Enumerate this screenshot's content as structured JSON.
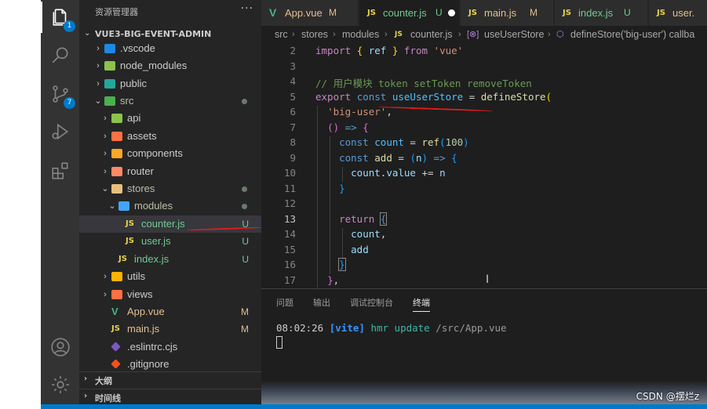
{
  "activity_bar": {
    "items": [
      {
        "name": "explorer-icon",
        "badge": "1"
      },
      {
        "name": "search-icon",
        "badge": ""
      },
      {
        "name": "source-control-icon",
        "badge": "7"
      },
      {
        "name": "run-debug-icon",
        "badge": ""
      },
      {
        "name": "extensions-icon",
        "badge": ""
      }
    ],
    "bottom": [
      {
        "name": "account-icon"
      },
      {
        "name": "settings-gear-icon"
      }
    ]
  },
  "sidebar": {
    "title": "资源管理器",
    "more": "···",
    "root": "VUE3-BIG-EVENT-ADMIN",
    "tree": [
      {
        "label": ".vscode",
        "icon": "folder-vscode",
        "twisty": "›",
        "status": "",
        "dot": false,
        "color": "#1e88e5",
        "kind": "folder"
      },
      {
        "label": "node_modules",
        "icon": "folder-node",
        "twisty": "›",
        "status": "",
        "dot": false,
        "color": "#8bc34a",
        "kind": "folder"
      },
      {
        "label": "public",
        "icon": "folder-public",
        "twisty": "›",
        "status": "",
        "dot": false,
        "color": "#26a69a",
        "kind": "folder"
      },
      {
        "label": "src",
        "icon": "folder-src",
        "twisty": "⌄",
        "status": "",
        "dot": true,
        "color": "#4caf50",
        "kind": "folder-open"
      },
      {
        "label": "api",
        "icon": "folder-api",
        "twisty": "›",
        "status": "",
        "dot": false,
        "color": "#8bc34a",
        "kind": "folder"
      },
      {
        "label": "assets",
        "icon": "folder-assets",
        "twisty": "›",
        "status": "",
        "dot": false,
        "color": "#ff7043",
        "kind": "folder"
      },
      {
        "label": "components",
        "icon": "folder-components",
        "twisty": "›",
        "status": "",
        "dot": false,
        "color": "#ffa726",
        "kind": "folder"
      },
      {
        "label": "router",
        "icon": "folder-router",
        "twisty": "›",
        "status": "",
        "dot": false,
        "color": "#ff8a65",
        "kind": "folder"
      },
      {
        "label": "stores",
        "icon": "folder-stores",
        "twisty": "⌄",
        "status": "",
        "dot": true,
        "color": "#e8c07d",
        "kind": "folder-open"
      },
      {
        "label": "modules",
        "icon": "folder-modules",
        "twisty": "⌄",
        "status": "",
        "dot": true,
        "color": "#42a5f5",
        "kind": "folder-open"
      },
      {
        "label": "counter.js",
        "icon": "js-file",
        "twisty": "",
        "status": "U",
        "dot": false,
        "color": "#e8d44d",
        "kind": "js",
        "selected": true
      },
      {
        "label": "user.js",
        "icon": "js-file",
        "twisty": "",
        "status": "U",
        "dot": false,
        "color": "#e8d44d",
        "kind": "js"
      },
      {
        "label": "index.js",
        "icon": "js-file",
        "twisty": "",
        "status": "U",
        "dot": false,
        "color": "#e8d44d",
        "kind": "js"
      },
      {
        "label": "utils",
        "icon": "folder-utils",
        "twisty": "›",
        "status": "",
        "dot": false,
        "color": "#ffb300",
        "kind": "folder"
      },
      {
        "label": "views",
        "icon": "folder-views",
        "twisty": "›",
        "status": "",
        "dot": false,
        "color": "#ff7043",
        "kind": "folder"
      },
      {
        "label": "App.vue",
        "icon": "vue-file",
        "twisty": "",
        "status": "M",
        "dot": false,
        "color": "#41b883",
        "kind": "vue"
      },
      {
        "label": "main.js",
        "icon": "js-file",
        "twisty": "",
        "status": "M",
        "dot": false,
        "color": "#e8d44d",
        "kind": "js"
      },
      {
        "label": ".eslintrc.cjs",
        "icon": "eslint-file",
        "twisty": "",
        "status": "",
        "dot": false,
        "color": "#7e57c2",
        "kind": "file"
      },
      {
        "label": ".gitignore",
        "icon": "git-file",
        "twisty": "",
        "status": "",
        "dot": false,
        "color": "#f4511e",
        "kind": "file"
      }
    ],
    "outline": "大纲",
    "timeline": "时间线"
  },
  "tabs": [
    {
      "icon": "vue",
      "icon_text": "V",
      "name": "App.vue",
      "status": "M",
      "active": false
    },
    {
      "icon": "js",
      "icon_text": "JS",
      "name": "counter.js",
      "status": "U",
      "active": true,
      "dirty": true
    },
    {
      "icon": "js",
      "icon_text": "JS",
      "name": "main.js",
      "status": "M",
      "active": false
    },
    {
      "icon": "js",
      "icon_text": "JS",
      "name": "index.js",
      "status": "U",
      "active": false
    },
    {
      "icon": "js",
      "icon_text": "JS",
      "name": "user.",
      "status": "",
      "active": false
    }
  ],
  "breadcrumb": {
    "parts": [
      "src",
      "stores",
      "modules"
    ],
    "file_icon": "JS",
    "file": "counter.js",
    "symbol1": "useUserStore",
    "symbol2": "defineStore('big-user') callba"
  },
  "editor": {
    "line_numbers": [
      "2",
      "3",
      "4",
      "5",
      "6",
      "7",
      "8",
      "9",
      "10",
      "11",
      "12",
      "13",
      "14",
      "15",
      "16",
      "17"
    ],
    "current_line": "13",
    "lines": [
      [
        [
          "kw-ctrl",
          "import "
        ],
        [
          "br1",
          "{ "
        ],
        [
          "var",
          "ref "
        ],
        [
          "br1",
          "} "
        ],
        [
          "kw-ctrl",
          "from "
        ],
        [
          "str",
          "'vue'"
        ]
      ],
      [],
      [
        [
          "cmt",
          "// 用户模块 token setToken removeToken"
        ]
      ],
      [
        [
          "kw-ctrl",
          "export "
        ],
        [
          "kw",
          "const "
        ],
        [
          "const",
          "useUserStore "
        ],
        [
          "pun",
          "= "
        ],
        [
          "fn",
          "defineStore"
        ],
        [
          "br1",
          "("
        ]
      ],
      [
        [
          "pun",
          "  "
        ],
        [
          "str",
          "'big-user'"
        ],
        [
          "pun",
          ","
        ]
      ],
      [
        [
          "pun",
          "  "
        ],
        [
          "br2",
          "()"
        ],
        [
          "kw",
          " => "
        ],
        [
          "br2",
          "{"
        ]
      ],
      [
        [
          "pun",
          "    "
        ],
        [
          "kw",
          "const "
        ],
        [
          "const",
          "count "
        ],
        [
          "pun",
          "= "
        ],
        [
          "fn",
          "ref"
        ],
        [
          "br3",
          "("
        ],
        [
          "num",
          "100"
        ],
        [
          "br3",
          ")"
        ]
      ],
      [
        [
          "pun",
          "    "
        ],
        [
          "kw",
          "const "
        ],
        [
          "fn",
          "add "
        ],
        [
          "pun",
          "= "
        ],
        [
          "br3",
          "("
        ],
        [
          "var",
          "n"
        ],
        [
          "br3",
          ")"
        ],
        [
          "kw",
          " => "
        ],
        [
          "br3",
          "{"
        ]
      ],
      [
        [
          "pun",
          "      "
        ],
        [
          "var",
          "count"
        ],
        [
          "pun",
          "."
        ],
        [
          "var",
          "value "
        ],
        [
          "pun",
          "+= "
        ],
        [
          "var",
          "n"
        ]
      ],
      [
        [
          "pun",
          "    "
        ],
        [
          "br3",
          "}"
        ]
      ],
      [],
      [
        [
          "pun",
          "    "
        ],
        [
          "kw-ctrl",
          "return "
        ],
        [
          "br3box",
          "{"
        ]
      ],
      [
        [
          "pun",
          "      "
        ],
        [
          "var",
          "count"
        ],
        [
          "pun",
          ","
        ]
      ],
      [
        [
          "pun",
          "      "
        ],
        [
          "var",
          "add"
        ]
      ],
      [
        [
          "pun",
          "    "
        ],
        [
          "br3box",
          "}"
        ]
      ],
      [
        [
          "pun",
          "  "
        ],
        [
          "br2",
          "}"
        ],
        [
          "pun",
          ","
        ]
      ]
    ]
  },
  "panel": {
    "tabs": [
      "问题",
      "输出",
      "调试控制台",
      "终端"
    ],
    "active_tab": "终端",
    "terminal": {
      "time": "08:02:26",
      "tag": "[vite]",
      "message": "hmr update",
      "path": "/src/App.vue"
    }
  },
  "watermark": "CSDN @摆烂z",
  "colors": {
    "accent": "#007acc",
    "annotation_red": "#e51c1c",
    "modified": "#e2c08d",
    "untracked": "#73c991"
  }
}
